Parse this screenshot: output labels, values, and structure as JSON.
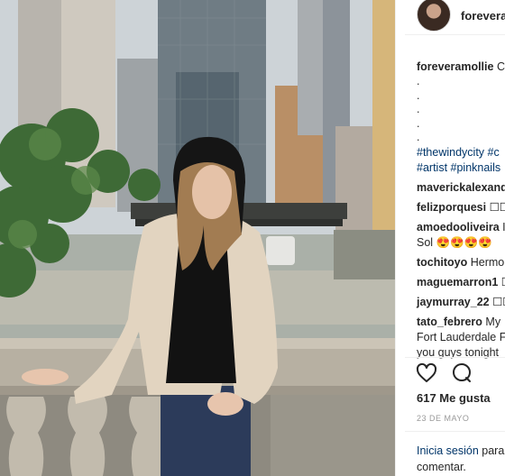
{
  "post": {
    "username": "foreveramollie",
    "header_username": "forevera",
    "likes": "617 Me gusta",
    "date": "23 DE MAYO",
    "login_prompt_link": "Inicia sesión",
    "login_prompt_rest": " para",
    "login_prompt_line2": "comentar."
  },
  "caption": {
    "username": "foreveramollie",
    "text": " C",
    "dots": ".\n.\n.\n.\n.",
    "hashtag_line1": "#thewindycity #c",
    "hashtag_line2": "#artist #pinknails"
  },
  "comments": [
    {
      "user": "maverickalexand",
      "text": ""
    },
    {
      "user": "felizporquesi",
      "text": " ☐☐"
    },
    {
      "user": "amoedooliveira",
      "text": " I",
      "line2": "Sol 😍😍😍😍"
    },
    {
      "user": "tochitoyo",
      "text": " Hermo"
    },
    {
      "user": "maguemarron1",
      "text": " ☐"
    },
    {
      "user": "jaymurray_22",
      "text": " ☐☐"
    },
    {
      "user": "tato_febrero",
      "text": " My",
      "line2": "Fort Lauderdale F",
      "line3": "you guys tonight"
    }
  ],
  "icons": {
    "avatar": "profile-avatar",
    "like": "heart-icon",
    "comment": "comment-bubble-icon"
  },
  "colors": {
    "link": "#003569",
    "text": "#262626",
    "muted": "#999999"
  }
}
